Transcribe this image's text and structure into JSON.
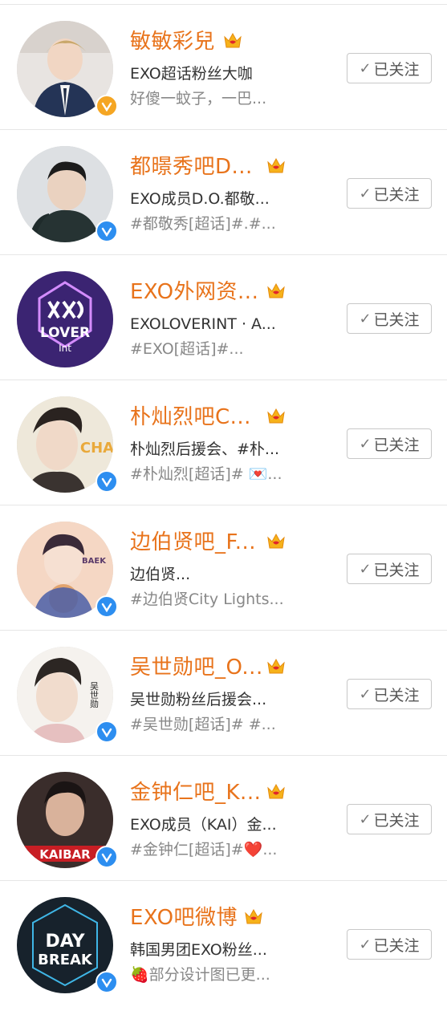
{
  "follow_label": "已关注",
  "follow_icon": "check-icon",
  "accounts": [
    {
      "name": "敏敏彩兒",
      "desc": "EXO超话粉丝大咖",
      "extra": "好傻一蚊子，一巴...",
      "verified": "gold",
      "avatar_text": "",
      "avatar_colors": [
        "#e9e2de",
        "#2c3a5a"
      ]
    },
    {
      "name": "都暻秀吧D...",
      "desc": "EXO成员D.O.都敬...",
      "extra": "#都敬秀[超话]#.#...",
      "verified": "blue",
      "avatar_text": "",
      "avatar_colors": [
        "#dfe0e2",
        "#1e2a2a"
      ]
    },
    {
      "name": "EXO外网资...",
      "desc": "EXOLOVERINT · A...",
      "extra": "#EXO[超话]#...",
      "verified": "none",
      "avatar_text": "LOVER",
      "avatar_text2": "Int",
      "avatar_colors": [
        "#3a2370",
        "#ffffff"
      ]
    },
    {
      "name": "朴灿烈吧C...",
      "desc": "朴灿烈后援会、#朴...",
      "extra": "#朴灿烈[超话]# 💌...",
      "verified": "blue",
      "avatar_text": "CHA",
      "avatar_colors": [
        "#efe9dc",
        "#e9a93b"
      ]
    },
    {
      "name": "边伯贤吧_F...",
      "desc": "边伯贤...",
      "extra": "#边伯贤City Lights...",
      "verified": "blue",
      "avatar_text": "BAEK",
      "avatar_colors": [
        "#f2c9b2",
        "#5a3a6a"
      ]
    },
    {
      "name": "吴世勋吧_O...",
      "desc": "吴世勋粉丝后援会...",
      "extra": "#吴世勋[超话]# #...",
      "verified": "blue",
      "avatar_text": "吴世勋",
      "avatar_colors": [
        "#f4f1ec",
        "#2a2a2a"
      ]
    },
    {
      "name": "金钟仁吧_K...",
      "desc": "EXO成员（KAI）金...",
      "extra": "#金钟仁[超话]#❤️...",
      "verified": "blue",
      "avatar_text": "KAIBAR",
      "avatar_colors": [
        "#2a1f1f",
        "#e0262b"
      ]
    },
    {
      "name": "EXO吧微博",
      "desc": "韩国男团EXO粉丝...",
      "extra": "🍓部分设计图已更...",
      "verified": "blue",
      "avatar_text": "DAY",
      "avatar_text2": "BREAK",
      "avatar_colors": [
        "#17222c",
        "#ffffff"
      ]
    }
  ]
}
